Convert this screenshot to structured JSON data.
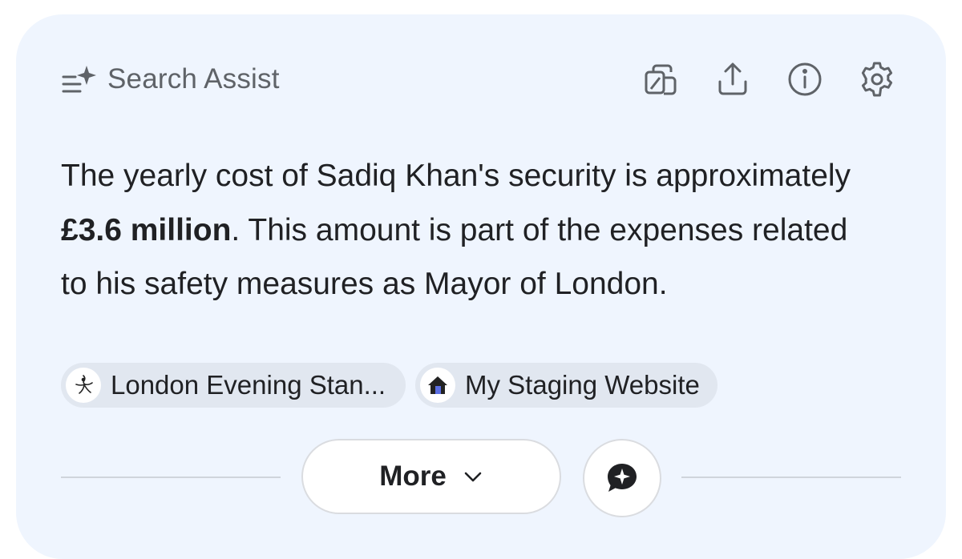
{
  "header": {
    "icon": "sparkle-list-icon",
    "title": "Search Assist"
  },
  "toolbar": {
    "icons": [
      "copy-icon",
      "share-icon",
      "info-icon",
      "settings-icon"
    ]
  },
  "answer": {
    "part1": "The yearly cost of Sadiq Khan's security is approximately ",
    "bold": "£3.6 million",
    "part2": ". This amount is part of the expenses related to his safety measures as Mayor of London."
  },
  "sources": [
    {
      "label": "London Evening Stan...",
      "icon": "evening-standard-favicon"
    },
    {
      "label": "My Staging Website",
      "icon": "house-favicon"
    }
  ],
  "actions": {
    "more_label": "More",
    "more_icon": "chevron-down-icon",
    "chat_icon": "chat-sparkle-icon"
  },
  "colors": {
    "card_background": "#eff5fe",
    "chip_background": "#e1e7f0",
    "text": "#202124",
    "muted": "#5f6368"
  }
}
